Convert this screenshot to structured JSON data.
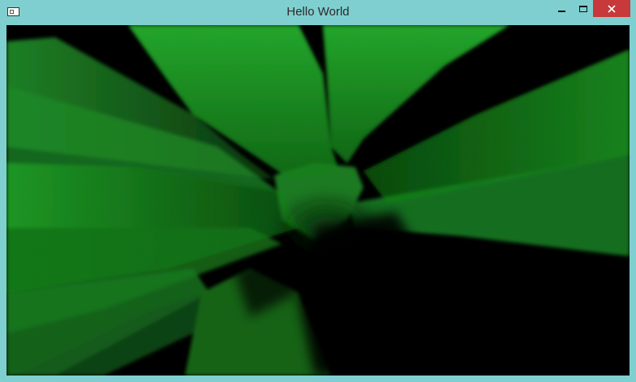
{
  "window": {
    "title": "Hello World",
    "icon": "app-window-icon",
    "controls": {
      "minimize_icon": "minimize-icon",
      "maximize_icon": "maximize-icon",
      "close_icon": "close-icon"
    },
    "colors": {
      "frame": "#7fcfd0",
      "close": "#c7393a",
      "canvas_background": "#000000",
      "render_green": "#1f8f2a"
    }
  }
}
